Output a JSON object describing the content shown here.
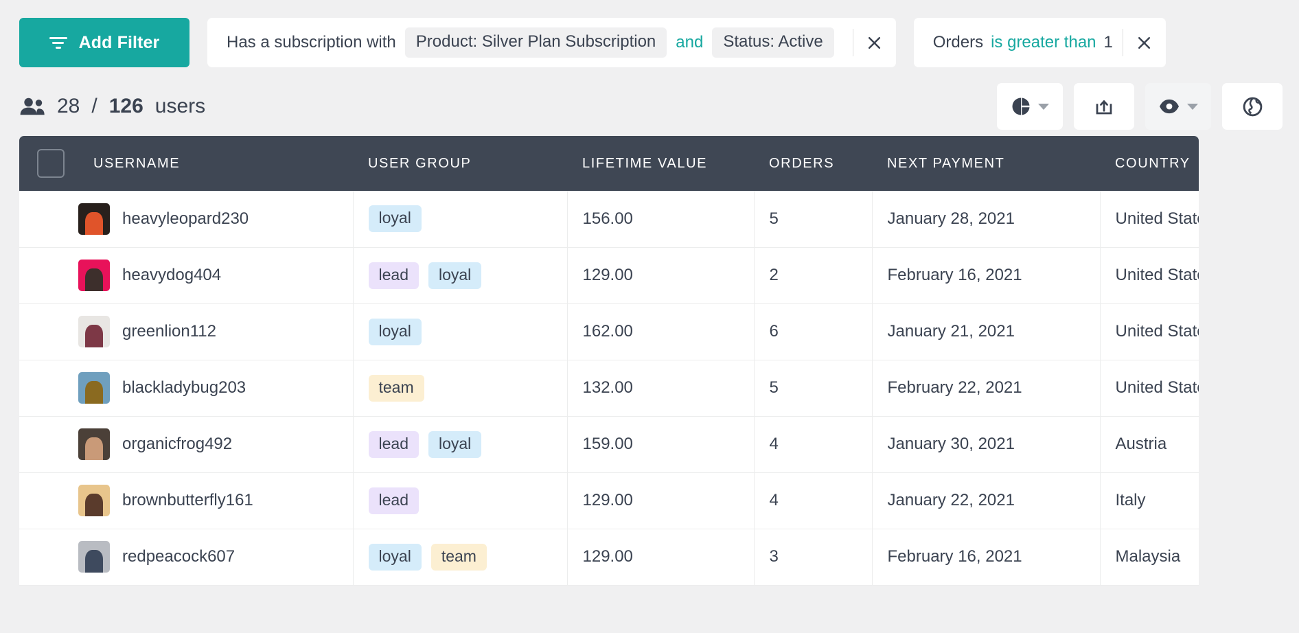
{
  "toolbar": {
    "add_filter_label": "Add Filter",
    "add_filter_icon": "filter-icon"
  },
  "filters": [
    {
      "prefix": "Has a subscription with",
      "pills": [
        "Product: Silver Plan Subscription",
        "Status: Active"
      ],
      "conjunction": "and",
      "close_label": "×"
    },
    {
      "field": "Orders",
      "operator": "is greater than",
      "value": "1",
      "close_label": "×"
    }
  ],
  "summary": {
    "icon": "people-icon",
    "shown": "28",
    "separator": "/",
    "total": "126",
    "unit": "users"
  },
  "view_tools": [
    {
      "name": "chart-view-button",
      "icon": "pie-chart-icon",
      "has_caret": true,
      "active": false
    },
    {
      "name": "export-button",
      "icon": "export-box-icon",
      "has_caret": false,
      "active": false
    },
    {
      "name": "visibility-button",
      "icon": "eye-icon",
      "has_caret": true,
      "active": true
    },
    {
      "name": "globe-button",
      "icon": "globe-icon",
      "has_caret": false,
      "active": false
    }
  ],
  "table": {
    "select_all_name": "select-all-checkbox",
    "columns": [
      "USERNAME",
      "USER GROUP",
      "LIFETIME VALUE",
      "ORDERS",
      "NEXT PAYMENT",
      "COUNTRY"
    ],
    "rows": [
      {
        "username": "heavyleopard230",
        "avatar_colors": [
          "#28201c",
          "#e0542a"
        ],
        "groups": [
          "loyal"
        ],
        "lifetime_value": "156.00",
        "orders": "5",
        "next_payment": "January 28, 2021",
        "country": "United States"
      },
      {
        "username": "heavydog404",
        "avatar_colors": [
          "#e8125a",
          "#3d2f2c"
        ],
        "groups": [
          "lead",
          "loyal"
        ],
        "lifetime_value": "129.00",
        "orders": "2",
        "next_payment": "February 16, 2021",
        "country": "United States"
      },
      {
        "username": "greenlion112",
        "avatar_colors": [
          "#e8e6e3",
          "#7d3846"
        ],
        "groups": [
          "loyal"
        ],
        "lifetime_value": "162.00",
        "orders": "6",
        "next_payment": "January 21, 2021",
        "country": "United States"
      },
      {
        "username": "blackladybug203",
        "avatar_colors": [
          "#6f9fbe",
          "#8a6a20"
        ],
        "groups": [
          "team"
        ],
        "lifetime_value": "132.00",
        "orders": "5",
        "next_payment": "February 22, 2021",
        "country": "United States"
      },
      {
        "username": "organicfrog492",
        "avatar_colors": [
          "#4b4038",
          "#c99a78"
        ],
        "groups": [
          "lead",
          "loyal"
        ],
        "lifetime_value": "159.00",
        "orders": "4",
        "next_payment": "January 30, 2021",
        "country": "Austria"
      },
      {
        "username": "brownbutterfly161",
        "avatar_colors": [
          "#e8c58c",
          "#5a3b2c"
        ],
        "groups": [
          "lead"
        ],
        "lifetime_value": "129.00",
        "orders": "4",
        "next_payment": "January 22, 2021",
        "country": "Italy"
      },
      {
        "username": "redpeacock607",
        "avatar_colors": [
          "#b9bcc2",
          "#3e4a5e"
        ],
        "groups": [
          "loyal",
          "team"
        ],
        "lifetime_value": "129.00",
        "orders": "3",
        "next_payment": "February 16, 2021",
        "country": "Malaysia"
      }
    ]
  },
  "colors": {
    "accent": "#17a8a0",
    "header_bg": "#3f4754",
    "page_bg": "#f0f0f1",
    "text": "#3b4351",
    "tag_loyal": "#d5ecfa",
    "tag_lead": "#ebe2fb",
    "tag_team": "#fcefd2"
  }
}
